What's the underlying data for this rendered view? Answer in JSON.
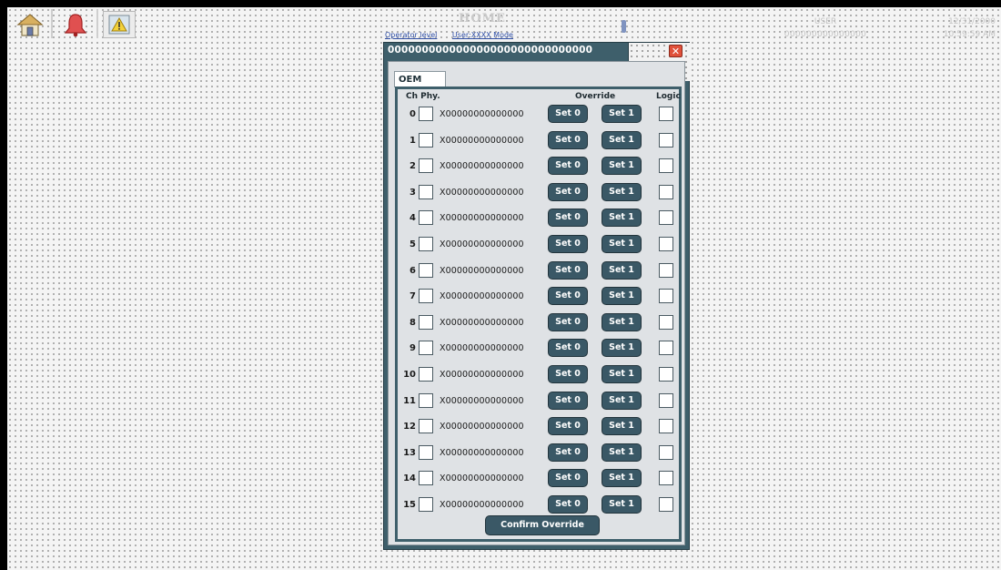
{
  "header": {
    "title": "HOME",
    "links": [
      "Operator level",
      "User:XXXX Mode"
    ],
    "user_label": "USER",
    "user_id": "000000000000000",
    "date": "12/31/2000",
    "time": "10:59:59 AM"
  },
  "toolbar": {
    "icons": [
      "home-icon",
      "alarm-bell-icon",
      "warning-icon"
    ]
  },
  "dialog": {
    "title": "000000000000000000000000000000",
    "close_glyph": "✕",
    "tab_label": "OEM",
    "col_ch_phy": "Ch Phy.",
    "col_override": "Override",
    "col_logic": "Logic",
    "set0_label": "Set 0",
    "set1_label": "Set 1",
    "confirm_label": "Confirm Override",
    "rows": [
      {
        "ch": "0",
        "name": "X00000000000000"
      },
      {
        "ch": "1",
        "name": "X00000000000000"
      },
      {
        "ch": "2",
        "name": "X00000000000000"
      },
      {
        "ch": "3",
        "name": "X00000000000000"
      },
      {
        "ch": "4",
        "name": "X00000000000000"
      },
      {
        "ch": "5",
        "name": "X00000000000000"
      },
      {
        "ch": "6",
        "name": "X00000000000000"
      },
      {
        "ch": "7",
        "name": "X00000000000000"
      },
      {
        "ch": "8",
        "name": "X00000000000000"
      },
      {
        "ch": "9",
        "name": "X00000000000000"
      },
      {
        "ch": "10",
        "name": "X00000000000000"
      },
      {
        "ch": "11",
        "name": "X00000000000000"
      },
      {
        "ch": "12",
        "name": "X00000000000000"
      },
      {
        "ch": "13",
        "name": "X00000000000000"
      },
      {
        "ch": "14",
        "name": "X00000000000000"
      },
      {
        "ch": "15",
        "name": "X00000000000000"
      }
    ]
  },
  "colors": {
    "dialog_frame": "#3e5f6b",
    "button_fill": "#3a5866",
    "close_button": "#e0503a",
    "panel_bg": "#dfe2e5"
  }
}
